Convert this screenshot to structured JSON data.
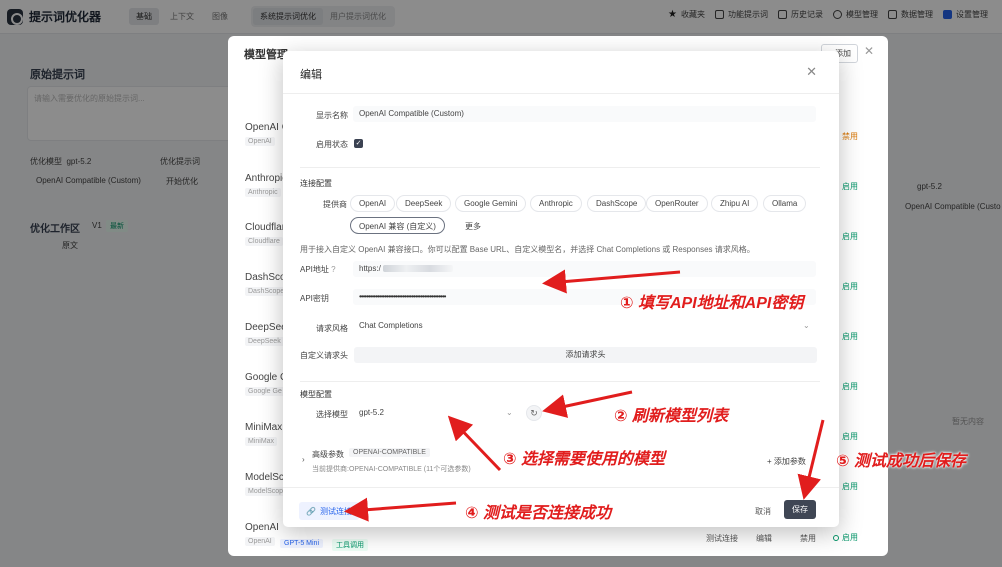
{
  "app": {
    "title": "提示词优化器"
  },
  "top_modes": [
    "基础",
    "上下文",
    "图像"
  ],
  "top_types": [
    "系统提示词优化",
    "用户提示词优化"
  ],
  "top_buttons": [
    "收藏夹",
    "功能提示词",
    "历史记录",
    "模型管理",
    "数据管理",
    "设置管理"
  ],
  "left": {
    "heading": "原始提示词",
    "placeholder": "请输入需要优化的原始提示词...",
    "model_label": "优化模型",
    "model_value": "gpt-5.2",
    "template_label": "优化提示词",
    "select_value": "OpenAI Compatible (Custom)",
    "optimize_btn": "开始优化",
    "workspace_heading": "优化工作区",
    "version": "V1",
    "version_tag": "最新",
    "tab": "原文"
  },
  "management": {
    "title": "模型管理",
    "add_label": "添加",
    "providers": [
      {
        "name": "OpenAI C",
        "tag": "OpenAI"
      },
      {
        "name": "Anthropic",
        "tag": "Anthropic"
      },
      {
        "name": "Cloudflare",
        "tag": "Cloudflare"
      },
      {
        "name": "DashScope",
        "tag": "DashScope"
      },
      {
        "name": "DeepSeek",
        "tag": "DeepSeek"
      },
      {
        "name": "Google Ge",
        "tag": "Google Ge"
      },
      {
        "name": "MiniMax",
        "tag": "MiniMax"
      },
      {
        "name": "ModelScope",
        "tag": "ModelScope"
      },
      {
        "name": "OpenAI",
        "tag": "OpenAI"
      }
    ],
    "row_actions": [
      "禁用",
      "启用",
      "启用",
      "启用",
      "启用",
      "启用",
      "启用",
      "启用",
      "启用"
    ],
    "last_row_tags": [
      "GPT-5 Mini",
      "工具调用"
    ],
    "footer_actions": [
      "测试连接",
      "编辑",
      "禁用"
    ]
  },
  "right_bg": {
    "model": "gpt-5.2",
    "select": "OpenAI Compatible (Custo",
    "empty": "暂无内容"
  },
  "modal": {
    "title": "编辑",
    "display_name_label": "显示名称",
    "display_name_value": "OpenAI Compatible (Custom)",
    "enabled_label": "启用状态",
    "connection_section": "连接配置",
    "provider_label": "提供商",
    "providers": [
      "OpenAI",
      "DeepSeek",
      "Google Gemini",
      "Anthropic",
      "DashScope",
      "OpenRouter",
      "Zhipu AI",
      "Ollama"
    ],
    "provider_selected": "OpenAI 兼容 (自定义)",
    "provider_more": "更多",
    "hint": "用于接入自定义 OpenAI 兼容接口。你可以配置 Base URL、自定义模型名，并选择 Chat Completions 或 Responses 请求风格。",
    "api_url_label": "API地址",
    "api_url_value": "https:/",
    "api_key_label": "API密钥",
    "api_key_value": "••••••••••••••••••••••••••••••••••••••••••••••••",
    "request_style_label": "请求风格",
    "request_style_value": "Chat Completions",
    "custom_header_label": "自定义请求头",
    "add_header_btn": "添加请求头",
    "model_section": "模型配置",
    "select_model_label": "选择模型",
    "select_model_value": "gpt-5.2",
    "advanced_label": "高级参数",
    "advanced_tag": "OPENAI-COMPATIBLE",
    "advanced_sub": "当前提供商:OPENAI-COMPATIBLE (11个可选参数)",
    "add_param": "添加参数",
    "test_btn": "测试连接",
    "cancel_btn": "取消",
    "save_btn": "保存"
  },
  "annotations": [
    "① 填写API地址和API密钥",
    "② 刷新模型列表",
    "③ 选择需要使用的模型",
    "④ 测试是否连接成功",
    "⑤ 测试成功后保存"
  ],
  "colors": {
    "annotation": "#e11d1d",
    "accent": "#2563eb",
    "save": "#3f4654"
  }
}
